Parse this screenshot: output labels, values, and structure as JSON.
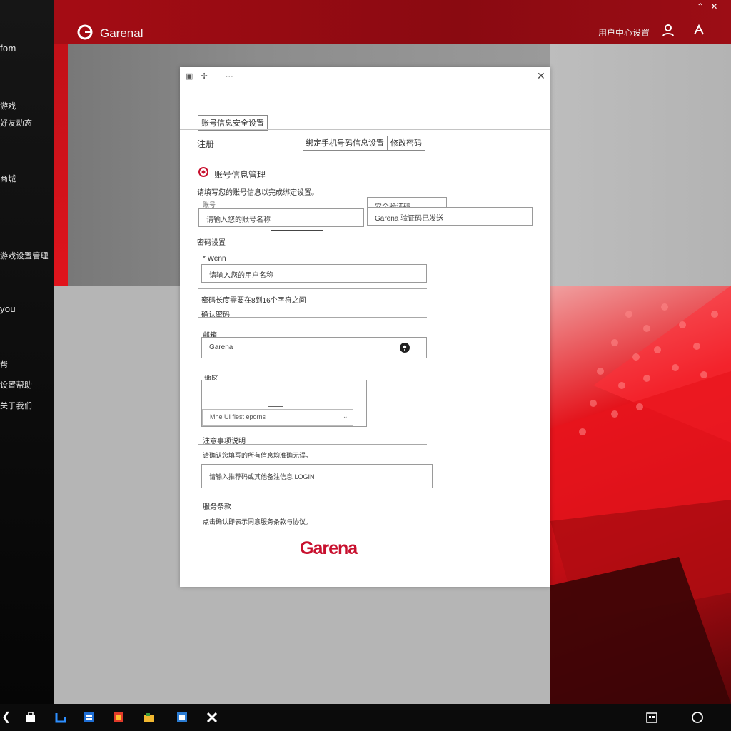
{
  "window": {
    "app_title": "Garenal",
    "header_right": "用户中心设置"
  },
  "sidebar": {
    "items": [
      {
        "label": "fom"
      },
      {
        "label": "游戏"
      },
      {
        "label": "好友动态"
      },
      {
        "label": "商城"
      },
      {
        "label": "游戏设置管理"
      },
      {
        "label": "you"
      },
      {
        "label": "帮"
      },
      {
        "label": "设置帮助"
      },
      {
        "label": "关于我们"
      }
    ]
  },
  "dialog": {
    "tab_account": "账号信息安全设置",
    "section_label": "注册",
    "tab_link_main": "绑定手机号码信息设置",
    "tab_link_small": "修改密码",
    "account_title": "账号信息管理",
    "account_desc": "请填写您的账号信息以完成绑定设置。",
    "input1_label": "账号",
    "input1_value": "请输入您的账号名称",
    "side_box_title": "安全验证码",
    "side_box_value": "Garena 验证码已发送",
    "divider_label": "密码设置",
    "name_label": "Wenn",
    "name_value": "请输入您的用户名称",
    "hint_text": "密码长度需要在8到16个字符之间",
    "password_label": "确认密码",
    "email_label": "邮箱",
    "email_value": "Garena",
    "dropdown_label": "地区",
    "dropdown_value": "Mhe UI fiest eporns",
    "notice_title": "注意事项说明",
    "notice_text": "请确认您填写的所有信息均准确无误。",
    "long_input_value": "请输入推荐码或其他备注信息 LOGIN",
    "footer_title": "服务条款",
    "footer_text": "点击确认即表示同意服务条款与协议。",
    "brand_logo": "Garena"
  },
  "colors": {
    "brand_red": "#c8102e",
    "titlebar": "#9b0c13"
  }
}
